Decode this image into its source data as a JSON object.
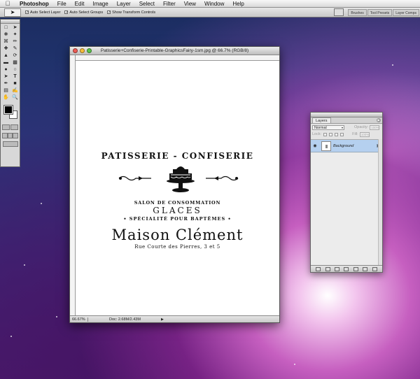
{
  "menubar": {
    "app_name": "Photoshop",
    "items": [
      "File",
      "Edit",
      "Image",
      "Layer",
      "Select",
      "Filter",
      "View",
      "Window",
      "Help"
    ]
  },
  "options_bar": {
    "auto_select_layer": "Auto Select Layer",
    "auto_select_groups": "Auto Select Groups",
    "show_transform_controls": "Show Transform Controls",
    "well_tabs": [
      "Brushes",
      "Tool Presets",
      "Layer Comps"
    ]
  },
  "document": {
    "title": "Patisserie+Confiserie-Printable-GraphicsFairy-1sm.jpg @ 66.7% (RGB/8)",
    "zoom": "66.67%",
    "doc_info": "Doc: 2.68M/2.43M",
    "artwork": {
      "line1": "PATISSERIE - CONFISERIE",
      "line2": "SALON DE CONSOMMATION",
      "line3": "GLACES",
      "line4": "• SPÉCIALITÉ POUR BAPTÊMES •",
      "line5": "Maison Clément",
      "line6": "Rue Courte des Pierres, 3 et 5"
    }
  },
  "layers_panel": {
    "tab": "Layers",
    "blend_mode": "Normal",
    "opacity_label": "Opacity:",
    "opacity_value": "100%",
    "lock_label": "Lock:",
    "fill_label": "Fill:",
    "fill_value": "100%",
    "layer_name": "Background"
  },
  "colors": {
    "layer_selected": "#b5d0ef",
    "foreground": "#000000",
    "background": "#ffffff"
  }
}
